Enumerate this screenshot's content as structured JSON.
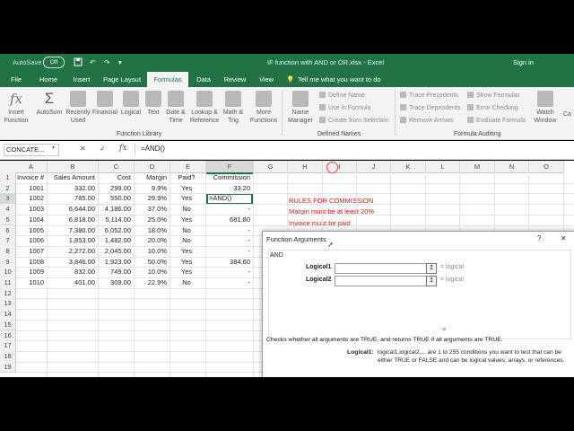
{
  "app": {
    "autosave_label": "AutoSave",
    "autosave_state": "Off",
    "title": "IF function with AND or OR.xlsx - Excel",
    "signin": "Sign in"
  },
  "tabs": [
    "File",
    "Home",
    "Insert",
    "Page Layout",
    "Formulas",
    "Data",
    "Review",
    "View"
  ],
  "active_tab": "Formulas",
  "tell_me": "Tell me what you want to do",
  "ribbon": {
    "insert_function": "Insert\nFunction",
    "autosum": "AutoSum",
    "recently_used": "Recently\nUsed",
    "financial": "Financial",
    "logical": "Logical",
    "text": "Text",
    "date_time": "Date &\nTime",
    "lookup_reference": "Lookup &\nReference",
    "math_trig": "Math &\nTrig",
    "more_functions": "More\nFunctions",
    "name_manager": "Name\nManager",
    "define_name": "Define Name",
    "use_in_formula": "Use in Formula",
    "create_from_selection": "Create from Selection",
    "trace_precedents": "Trace Precedents",
    "trace_dependents": "Trace Dependents",
    "remove_arrows": "Remove Arrows",
    "show_formulas": "Show Formulas",
    "error_checking": "Error Checking",
    "evaluate_formula": "Evaluate Formula",
    "watch_window": "Watch\nWindow",
    "calc_cut": "Ca",
    "group_function_library": "Function Library",
    "group_defined_names": "Defined Names",
    "group_formula_auditing": "Formula Auditing"
  },
  "formula_bar": {
    "name_box": "CONCATE...",
    "cancel": "✕",
    "enter": "✓",
    "fx": "fx",
    "formula": "=AND()"
  },
  "columns": [
    "A",
    "B",
    "C",
    "D",
    "E",
    "F",
    "G",
    "H",
    "I",
    "J",
    "K",
    "L",
    "M",
    "N",
    "O"
  ],
  "rows": [
    {
      "n": "1",
      "a": "Invoice #",
      "b": "Sales Amount",
      "c": "Cost",
      "d": "Margin",
      "e": "Paid?",
      "f": "Commission"
    },
    {
      "n": "2",
      "a": "1001",
      "b": "332.00",
      "c": "299.00",
      "d": "9.9%",
      "e": "Yes",
      "f": "33.20"
    },
    {
      "n": "3",
      "a": "1002",
      "b": "785.00",
      "c": "550.00",
      "d": "29.9%",
      "e": "Yes",
      "f": "=AND()"
    },
    {
      "n": "4",
      "a": "1003",
      "b": "6,644.00",
      "c": "4,186.00",
      "d": "37.0%",
      "e": "No",
      "f": "-"
    },
    {
      "n": "5",
      "a": "1004",
      "b": "6,818.00",
      "c": "5,114.00",
      "d": "25.0%",
      "e": "Yes",
      "f": "681.80"
    },
    {
      "n": "6",
      "a": "1005",
      "b": "7,380.00",
      "c": "6,052.00",
      "d": "18.0%",
      "e": "No",
      "f": "-"
    },
    {
      "n": "7",
      "a": "1006",
      "b": "1,853.00",
      "c": "1,482.00",
      "d": "20.0%",
      "e": "No",
      "f": "-"
    },
    {
      "n": "8",
      "a": "1007",
      "b": "2,272.00",
      "c": "2,045.00",
      "d": "10.0%",
      "e": "Yes",
      "f": "-"
    },
    {
      "n": "9",
      "a": "1008",
      "b": "3,846.00",
      "c": "1,923.00",
      "d": "50.0%",
      "e": "Yes",
      "f": "384.60"
    },
    {
      "n": "10",
      "a": "1009",
      "b": "832.00",
      "c": "749.00",
      "d": "10.0%",
      "e": "Yes",
      "f": "-"
    },
    {
      "n": "11",
      "a": "1010",
      "b": "401.00",
      "c": "309.00",
      "d": "22.9%",
      "e": "No",
      "f": "-"
    },
    {
      "n": "12"
    },
    {
      "n": "13"
    },
    {
      "n": "14"
    },
    {
      "n": "15"
    },
    {
      "n": "16"
    },
    {
      "n": "17"
    },
    {
      "n": "18"
    },
    {
      "n": "19"
    }
  ],
  "rules": [
    "RULES FOR COMMISSION",
    "Margin must be at least 20%",
    "Invoice must be paid"
  ],
  "dialog": {
    "title": "Function Arguments",
    "help": "?",
    "close": "✕",
    "function_name": "AND",
    "arg1_label": "Logical1",
    "arg2_label": "Logical2",
    "arg1_result": "=  logical",
    "arg2_result": "=  logical",
    "result_eq": "=",
    "description": "Checks whether all arguments are TRUE, and returns TRUE if all arguments are TRUE.",
    "param_label": "Logical1:",
    "param_desc_1": "logical1,logical2,... are 1 to 255 conditions you want to test that can be",
    "param_desc_2": "either TRUE or FALSE and can be logical values, arrays, or references."
  },
  "colors": {
    "excel_green": "#217346",
    "rules_red": "#dd1111",
    "selection_green": "#217346"
  }
}
